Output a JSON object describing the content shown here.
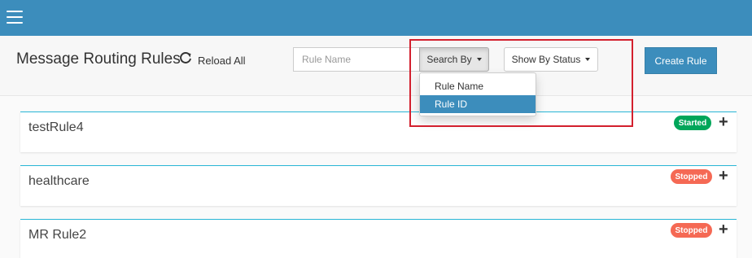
{
  "header": {
    "menu_icon": "hamburger-menu-icon"
  },
  "toolbar": {
    "title": "Message Routing Rules",
    "reload_icon": "refresh-icon",
    "reload_label": "Reload All",
    "search_placeholder": "Rule Name",
    "search_by_label": "Search By",
    "show_by_status_label": "Show By Status",
    "create_label": "Create Rule"
  },
  "search_by_menu": {
    "options": [
      "Rule Name",
      "Rule ID"
    ],
    "selected": "Rule ID"
  },
  "colors": {
    "header": "#3c8dbc",
    "primary_button": "#3c8dbc",
    "started": "#00a65a",
    "stopped": "#f56954",
    "card_border": "#29b6d6",
    "highlight": "#d3202e"
  },
  "rules": [
    {
      "name": "testRule4",
      "status": "Started"
    },
    {
      "name": "healthcare",
      "status": "Stopped"
    },
    {
      "name": "MR Rule2",
      "status": "Stopped"
    }
  ]
}
